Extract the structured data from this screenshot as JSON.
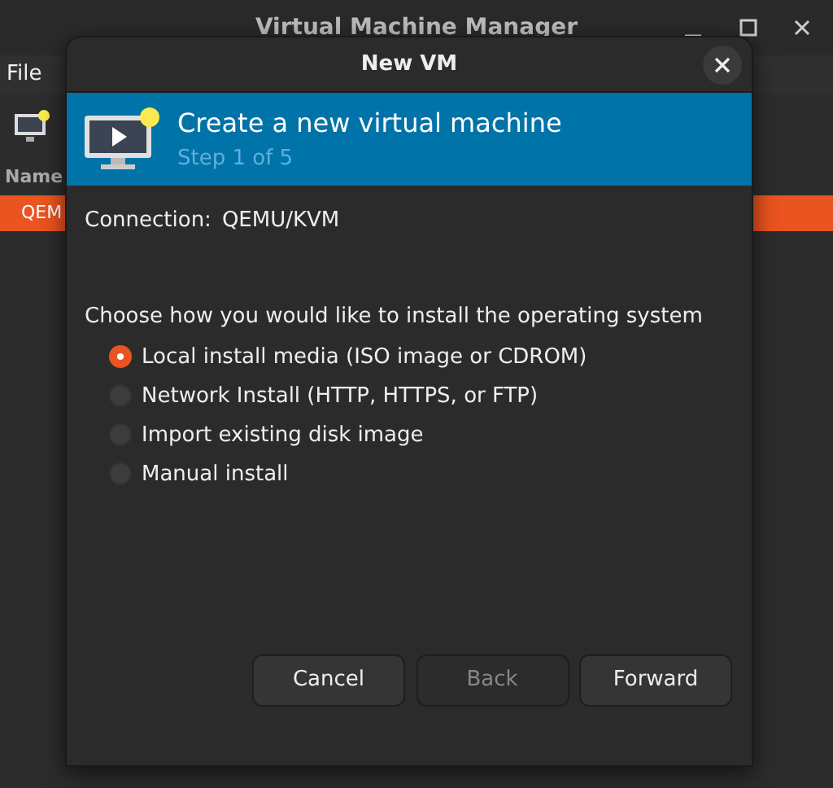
{
  "window": {
    "title": "Virtual Machine Manager",
    "menu": [
      "File"
    ],
    "list_header": "Name",
    "rows": [
      {
        "label": "QEM",
        "selected": true
      }
    ]
  },
  "dialog": {
    "title": "New VM",
    "banner": {
      "title": "Create a new virtual machine",
      "subtitle": "Step 1 of 5"
    },
    "connection": {
      "label": "Connection:",
      "value": "QEMU/KVM"
    },
    "prompt": "Choose how you would like to install the operating system",
    "options": [
      {
        "label": "Local install media (ISO image or CDROM)",
        "selected": true
      },
      {
        "label": "Network Install (HTTP, HTTPS, or FTP)",
        "selected": false
      },
      {
        "label": "Import existing disk image",
        "selected": false
      },
      {
        "label": "Manual install",
        "selected": false
      }
    ],
    "buttons": [
      {
        "label": "Cancel",
        "disabled": false
      },
      {
        "label": "Back",
        "disabled": true
      },
      {
        "label": "Forward",
        "disabled": false
      }
    ]
  }
}
